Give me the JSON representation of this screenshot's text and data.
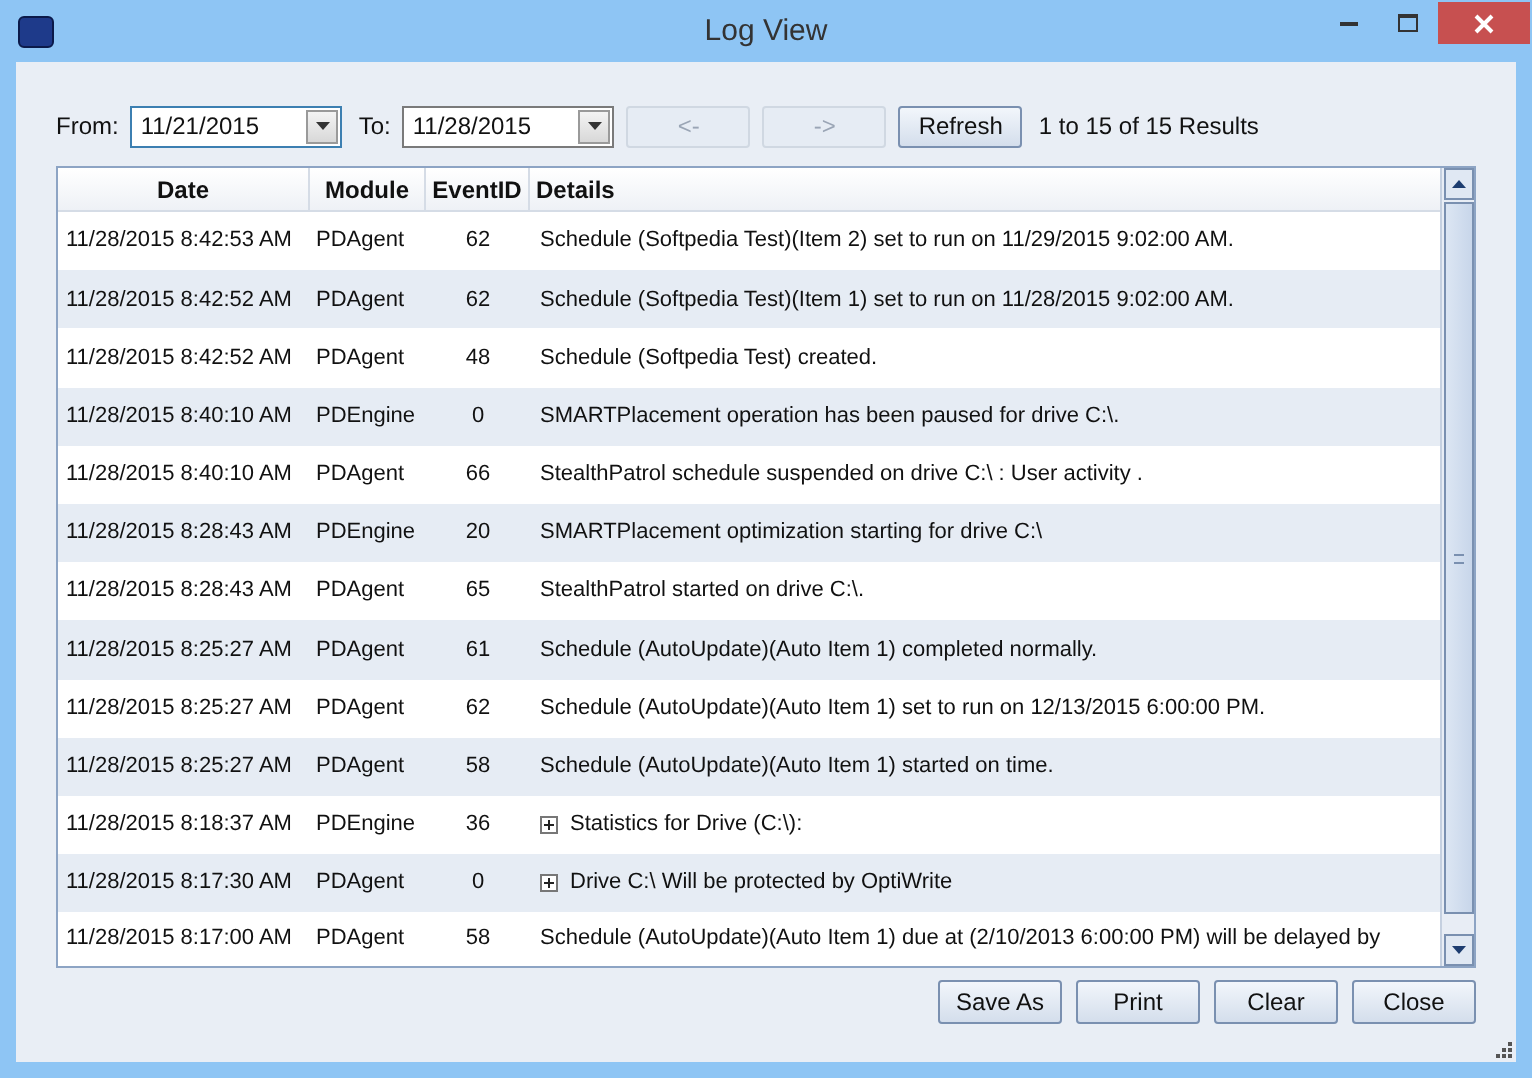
{
  "window": {
    "title": "Log View"
  },
  "filters": {
    "from_label": "From:",
    "from_value": "11/21/2015",
    "to_label": "To:",
    "to_value": "11/28/2015"
  },
  "nav_buttons": [
    {
      "label": "<-",
      "disabled": true
    },
    {
      "label": "->",
      "disabled": true
    },
    {
      "label": "Refresh",
      "disabled": false
    }
  ],
  "results": "1 to 15 of 15 Results",
  "table": {
    "columns": [
      "Date",
      "Module",
      "EventID",
      "Details"
    ],
    "rows": [
      {
        "date": "11/28/2015 8:42:53 AM",
        "module": "PDAgent",
        "event_id": "62",
        "details": "Schedule (Softpedia Test)(Item 2) set to run on 11/29/2015 9:02:00 AM.",
        "expandable": false
      },
      {
        "date": "11/28/2015 8:42:52 AM",
        "module": "PDAgent",
        "event_id": "62",
        "details": "Schedule (Softpedia Test)(Item 1) set to run on 11/28/2015 9:02:00 AM.",
        "expandable": false
      },
      {
        "date": "11/28/2015 8:42:52 AM",
        "module": "PDAgent",
        "event_id": "48",
        "details": "Schedule (Softpedia Test) created.",
        "expandable": false
      },
      {
        "date": "11/28/2015 8:40:10 AM",
        "module": "PDEngine",
        "event_id": "0",
        "details": "SMARTPlacement operation has been paused for drive C:\\.",
        "expandable": false
      },
      {
        "date": "11/28/2015 8:40:10 AM",
        "module": "PDAgent",
        "event_id": "66",
        "details": "StealthPatrol schedule suspended on drive C:\\ :  User activity  .",
        "expandable": false
      },
      {
        "date": "11/28/2015 8:28:43 AM",
        "module": "PDEngine",
        "event_id": "20",
        "details": "SMARTPlacement optimization starting for drive C:\\",
        "expandable": false
      },
      {
        "date": "11/28/2015 8:28:43 AM",
        "module": "PDAgent",
        "event_id": "65",
        "details": "StealthPatrol started on drive C:\\.",
        "expandable": false
      },
      {
        "date": "11/28/2015 8:25:27 AM",
        "module": "PDAgent",
        "event_id": "61",
        "details": "Schedule (AutoUpdate)(Auto Item 1) completed normally.",
        "expandable": false
      },
      {
        "date": "11/28/2015 8:25:27 AM",
        "module": "PDAgent",
        "event_id": "62",
        "details": "Schedule (AutoUpdate)(Auto Item 1) set to run on 12/13/2015 6:00:00 PM.",
        "expandable": false
      },
      {
        "date": "11/28/2015 8:25:27 AM",
        "module": "PDAgent",
        "event_id": "58",
        "details": "Schedule (AutoUpdate)(Auto Item 1) started on time.",
        "expandable": false
      },
      {
        "date": "11/28/2015 8:18:37 AM",
        "module": "PDEngine",
        "event_id": "36",
        "details": "Statistics for Drive (C:\\):",
        "expandable": true
      },
      {
        "date": "11/28/2015 8:17:30 AM",
        "module": "PDAgent",
        "event_id": "0",
        "details": "Drive C:\\ Will be protected by OptiWrite",
        "expandable": true
      },
      {
        "date": "11/28/2015 8:17:00 AM",
        "module": "PDAgent",
        "event_id": "58",
        "details": "Schedule (AutoUpdate)(Auto Item 1) due at (2/10/2013 6:00:00 PM) will be delayed by",
        "expandable": false
      }
    ]
  },
  "buttons": [
    "Save As",
    "Print",
    "Clear",
    "Close"
  ]
}
